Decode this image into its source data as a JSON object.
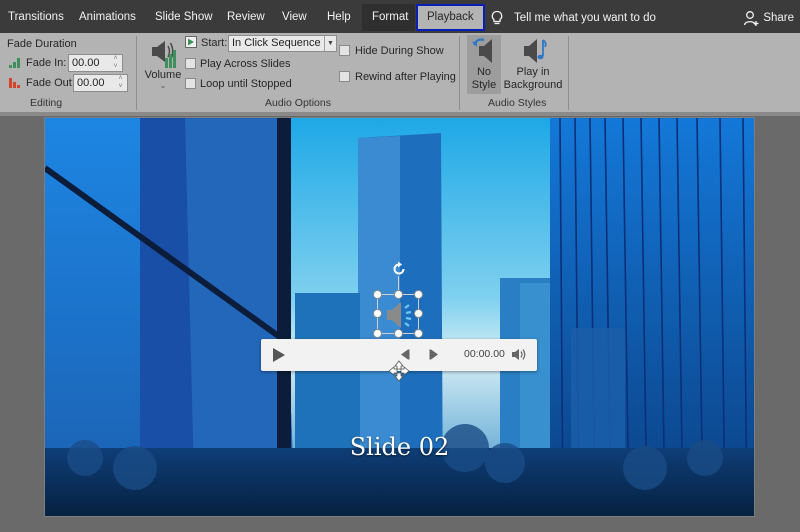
{
  "tabs": [
    {
      "label": "Transitions",
      "active": false
    },
    {
      "label": "Animations",
      "active": false
    },
    {
      "label": "Slide Show",
      "active": false
    },
    {
      "label": "Review",
      "active": false
    },
    {
      "label": "View",
      "active": false
    },
    {
      "label": "Help",
      "active": false
    },
    {
      "label": "Format",
      "active": false
    },
    {
      "label": "Playback",
      "active": true
    }
  ],
  "tell_me": {
    "icon": "lightbulb-icon",
    "label": "Tell me what you want to do"
  },
  "share": {
    "icon": "person-add-icon",
    "label": "Share"
  },
  "ribbon": {
    "editing": {
      "group_label": "Editing",
      "fade_duration_label": "Fade Duration",
      "fade_in_label": "Fade In:",
      "fade_in_value": "00.00",
      "fade_out_label": "Fade Out:",
      "fade_out_value": "00.00"
    },
    "audio_options": {
      "group_label": "Audio Options",
      "volume_label": "Volume",
      "start_label": "Start:",
      "start_value": "In Click Sequence",
      "play_across_slides": {
        "label": "Play Across Slides",
        "checked": false
      },
      "loop_until_stopped": {
        "label": "Loop until Stopped",
        "checked": false
      },
      "hide_during_show": {
        "label": "Hide During Show",
        "checked": false
      },
      "rewind_after_playing": {
        "label": "Rewind after Playing",
        "checked": false
      }
    },
    "audio_styles": {
      "group_label": "Audio Styles",
      "no_style_line1": "No",
      "no_style_line2": "Style",
      "play_bg_line1": "Play in",
      "play_bg_line2": "Background"
    }
  },
  "slide": {
    "title": "Slide 02",
    "player": {
      "time": "00:00.00"
    }
  },
  "colors": {
    "tabbar": "#3b3b3b",
    "ribbon": "#b3b3b3",
    "playback_outline": "#0a1fb8",
    "fade_in_icon": "#3f8f5c",
    "fade_out_icon": "#d0452a"
  }
}
